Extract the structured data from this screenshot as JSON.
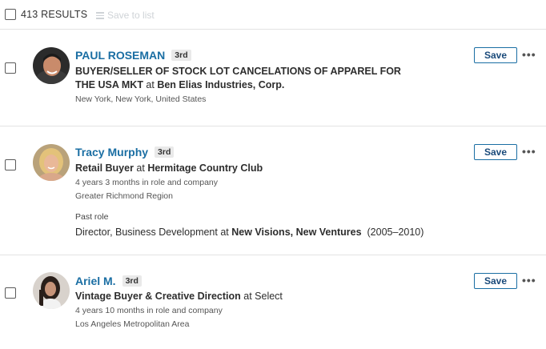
{
  "header": {
    "results_label": "413 RESULTS",
    "save_to_list_label": "Save to list"
  },
  "results": [
    {
      "name": "PAUL ROSEMAN",
      "degree": "3rd",
      "headline_role": "BUYER/SELLER OF STOCK LOT CANCELATIONS OF APPAREL FOR THE USA MKT",
      "headline_connector": " at ",
      "headline_company": "Ben Elias Industries, Corp.",
      "location": "New York, New York, United States",
      "save_label": "Save",
      "more_label": "•••"
    },
    {
      "name": "Tracy Murphy",
      "degree": "3rd",
      "headline_role": "Retail Buyer",
      "headline_connector": " at ",
      "headline_company": "Hermitage Country Club",
      "tenure": "4 years 3 months in role and company",
      "location": "Greater Richmond Region",
      "past_role_label": "Past role",
      "past_role_title": "Director, Business Development at ",
      "past_role_company": "New Visions, New Ventures",
      "past_role_years": "  (2005–2010)",
      "save_label": "Save",
      "more_label": "•••"
    },
    {
      "name": "Ariel M.",
      "degree": "3rd",
      "headline_role": "Vintage Buyer & Creative Direction",
      "headline_connector": " at ",
      "headline_company": "Select",
      "tenure": "4 years 10 months in role and company",
      "location": "Los Angeles Metropolitan Area",
      "save_label": "Save",
      "more_label": "•••"
    }
  ],
  "colors": {
    "link": "#1a6ea3",
    "divider": "#e3e3e3",
    "badge_bg": "#e9e9e9"
  }
}
